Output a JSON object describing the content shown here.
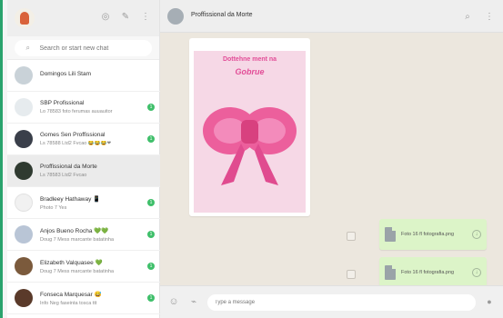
{
  "sidebar": {
    "search": {
      "placeholder": "Search or start new chat"
    },
    "chats": [
      {
        "name": "Domingos Lili Stam",
        "snippet": "",
        "time": "",
        "badge": "",
        "avatar_color": "#c9d2d8"
      },
      {
        "name": "SBP Profissional",
        "snippet": "Lo 78583 foto ferumas auuauitor",
        "time": "",
        "badge": "1",
        "avatar_color": "#e6ebee"
      },
      {
        "name": "Gomes Sen Proffissional",
        "snippet": "Ls 78588 Ltd2 Fvcao 😂😂😂❤",
        "time": "",
        "badge": "1",
        "avatar_color": "#3a3f4a"
      },
      {
        "name": "Proffissional da Morte",
        "snippet": "Ls 78583 Ltd2 Fvcao",
        "time": "",
        "badge": "",
        "avatar_color": "#2f3a30"
      },
      {
        "name": "Bradleey Hathaway 📱",
        "snippet": "Photo 7 Yes",
        "time": "",
        "badge": "1",
        "avatar_color": "#f1f1f1"
      },
      {
        "name": "Anjos Bueno Rocha 💚💚",
        "snippet": "Doug 7 Mess marcante batatinha",
        "time": "",
        "badge": "1",
        "avatar_color": "#b9c5d6"
      },
      {
        "name": "Elizabeth Valquasee 💚",
        "snippet": "Doug 7 Mess marcante batatinha",
        "time": "",
        "badge": "1",
        "avatar_color": "#7b5a3c"
      },
      {
        "name": "Fonseca Marquesar 😅",
        "snippet": "Info Neg faseinta tosca ttt",
        "time": "",
        "badge": "1",
        "avatar_color": "#5a3a2a"
      }
    ]
  },
  "main": {
    "contact_name": "Proffissional da Morte",
    "contact_status": "",
    "incoming_image": {
      "file_label": "",
      "title_line1": "Dottehne ment na",
      "title_line2": "Gobrue",
      "footer": ""
    },
    "outgoing_docs": [
      {
        "name": "Foto 16 fl fotografia.png"
      },
      {
        "name": "Foto 16 fl fotografia.png"
      }
    ],
    "composer": {
      "placeholder": "Type a message"
    }
  },
  "colors": {
    "accent": "#2aa36d",
    "badge": "#3fbf6a",
    "outgoing_bubble": "#dcf4c8",
    "chat_bg": "#ece7de"
  }
}
